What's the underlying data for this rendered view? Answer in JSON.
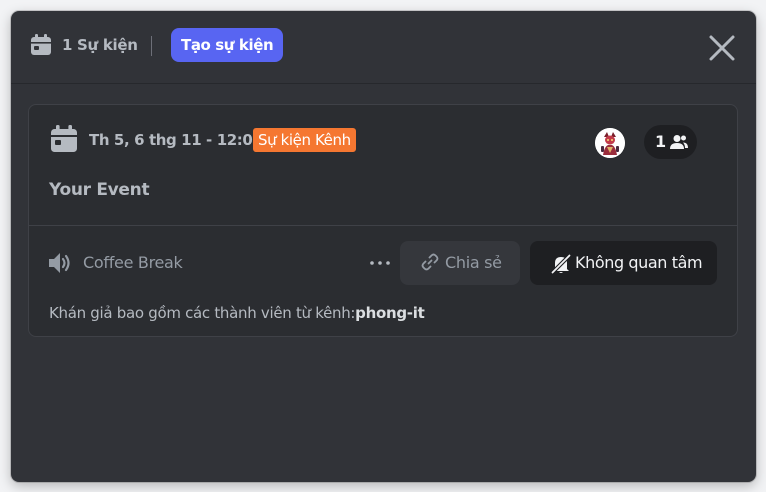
{
  "header": {
    "event_count_label": "1 Sự kiện",
    "create_button_label": "Tạo sự kiện",
    "icons": {
      "calendar": "calendar-icon",
      "close": "close-icon"
    }
  },
  "event": {
    "date_time": "Th 5, 6 thg 11 - 12:00",
    "type_badge": "Sự kiện Kênh",
    "title": "Your Event",
    "interested_count": "1",
    "channel_name": "Coffee Break",
    "share_label": "Chia sẻ",
    "not_interested_label": "Không quan tâm",
    "audience_prefix": "Khán giả bao gồm các thành viên từ kênh:",
    "audience_channel": "phong-it",
    "icons": {
      "calendar": "calendar-icon",
      "avatar": "avatar",
      "people": "people-icon",
      "speaker": "speaker-icon",
      "more": "more-dots-icon",
      "share": "link-icon",
      "not_interested": "bell-off-icon"
    }
  },
  "colors": {
    "modal_bg": "#313338",
    "accent": "#5865f2",
    "badge": "#f57731",
    "text_muted": "#b5bac1",
    "text_bright": "#f2f3f5"
  }
}
